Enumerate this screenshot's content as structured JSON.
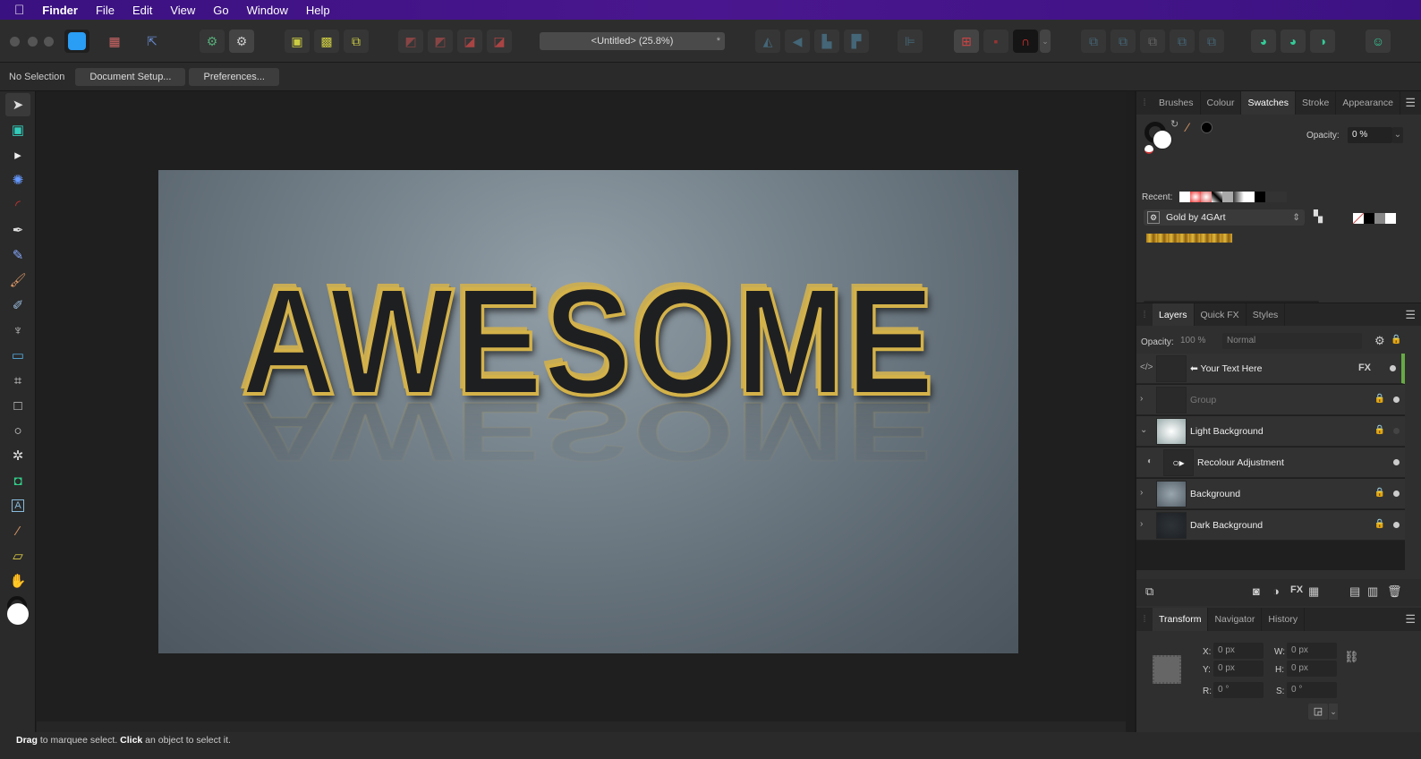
{
  "menubar": {
    "apple": "",
    "items": [
      "Finder",
      "File",
      "Edit",
      "View",
      "Go",
      "Window",
      "Help"
    ]
  },
  "toolbar": {
    "document_title": "<Untitled> (25.8%)",
    "modified_marker": "*"
  },
  "context": {
    "selection": "No Selection",
    "document_setup": "Document Setup...",
    "preferences": "Preferences..."
  },
  "tools": [
    "move",
    "artboard",
    "node",
    "contour",
    "corner",
    "pen",
    "pencil",
    "vector-brush",
    "paint-brush",
    "fill",
    "transparency",
    "place-image",
    "crop",
    "rectangle",
    "ellipse",
    "custom-shape",
    "vector-crop",
    "artistic-text",
    "color-picker",
    "measure",
    "view-hand"
  ],
  "canvas": {
    "headline": "AWESOME"
  },
  "swatches_panel": {
    "tabs": [
      "Brushes",
      "Colour",
      "Swatches",
      "Stroke",
      "Appearance"
    ],
    "active_tab": "Swatches",
    "opacity_label": "Opacity:",
    "opacity_value": "0 %",
    "recent_label": "Recent:",
    "palette": "Gold by 4GArt",
    "search_placeholder": ""
  },
  "layers_panel": {
    "tabs": [
      "Layers",
      "Quick FX",
      "Styles"
    ],
    "active_tab": "Layers",
    "opacity_label": "Opacity:",
    "opacity_value": "100 %",
    "blend_mode": "Normal",
    "layers": [
      {
        "name": "Your Text Here",
        "fx": "FX"
      },
      {
        "name": "Group"
      },
      {
        "name": "Light Background"
      },
      {
        "name": "Recolour Adjustment"
      },
      {
        "name": "Background"
      },
      {
        "name": "Dark Background"
      }
    ]
  },
  "transform_panel": {
    "tabs": [
      "Transform",
      "Navigator",
      "History"
    ],
    "active_tab": "Transform",
    "x_label": "X:",
    "x": "0 px",
    "y_label": "Y:",
    "y": "0 px",
    "w_label": "W:",
    "w": "0 px",
    "h_label": "H:",
    "h": "0 px",
    "r_label": "R:",
    "r": "0 °",
    "s_label": "S:",
    "s": "0 °"
  },
  "status": {
    "drag": "Drag",
    "drag_text": " to marquee select. ",
    "click": "Click",
    "click_text": " an object to select it."
  },
  "colors": {
    "accent": "#2a9df4",
    "menubar": "#3a1180",
    "gold": "#d4b24a"
  }
}
